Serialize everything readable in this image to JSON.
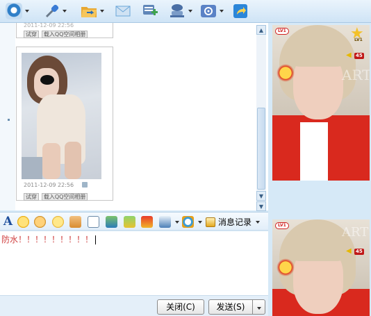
{
  "toolbar": {
    "items": [
      {
        "icon": "video-call-icon",
        "color": "#2f7fc8"
      },
      {
        "icon": "microphone-icon",
        "color": "#3a7bd5"
      },
      {
        "icon": "folder-transfer-icon",
        "color": "#e8a832"
      },
      {
        "icon": "mail-icon",
        "color": "#6aa6d8"
      },
      {
        "icon": "add-chat-icon",
        "color": "#3fa34d"
      },
      {
        "icon": "remote-assist-icon",
        "color": "#4a6fa5"
      },
      {
        "icon": "app-settings-icon",
        "color": "#5a82c6"
      },
      {
        "icon": "share-arrow-icon",
        "color": "#2b86d9"
      }
    ]
  },
  "chat": {
    "photo_top": {
      "timestamp": "2011-12-09 22:56",
      "btn_try": "试穿",
      "btn_import": "载入QQ空间相册"
    },
    "photo_main": {
      "timestamp": "2011-12-09 22:56",
      "btn_try": "试穿",
      "btn_import": "载入QQ空间相册"
    }
  },
  "format_bar": {
    "font_label": "A",
    "history_label": "消息记录"
  },
  "input": {
    "text": "防水！！！！！！！！！"
  },
  "buttons": {
    "close": "关闭(C)",
    "send": "发送(S)"
  },
  "sidebar": {
    "top": {
      "level": "LV1",
      "stars": "LV1",
      "count": "45",
      "watermark": "ARTS"
    },
    "bottom": {
      "level": "LV1",
      "count": "45",
      "watermark": "ARTS"
    }
  }
}
